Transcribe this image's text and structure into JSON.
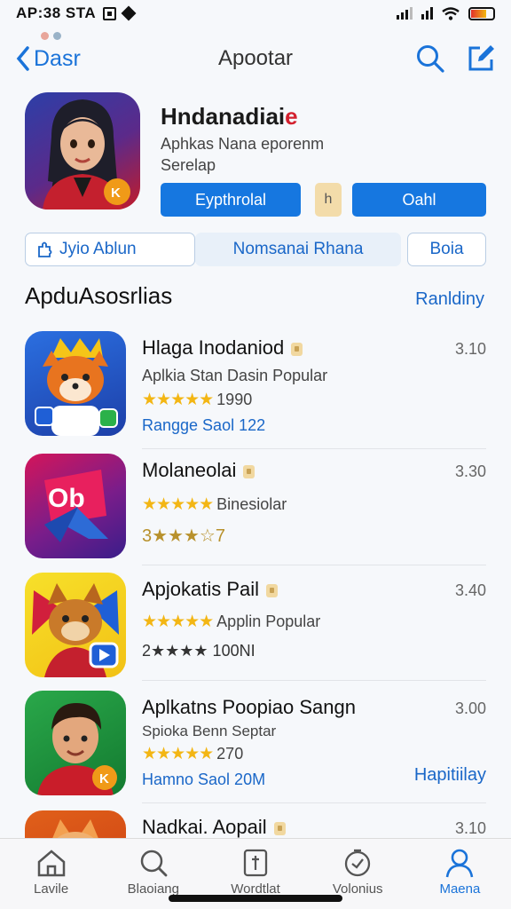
{
  "status": {
    "time": "AP:38 STA"
  },
  "nav": {
    "back_label": "Dasr",
    "title": "Apootar"
  },
  "hero": {
    "title": "Hndanadiai",
    "title_accent": "e",
    "subtitle": "Aphkas Nana eporenm",
    "subtitle2": "Serelap",
    "primary_button": "Eypthrolal",
    "small_button": "h",
    "secondary_button": "Oahl"
  },
  "tabs": [
    {
      "label": "Jyio Ablun"
    },
    {
      "label": "Nomsanai Rhana"
    },
    {
      "label": "Boia"
    }
  ],
  "section": {
    "title": "ApduAsosrlias",
    "link": "Ranldiny"
  },
  "apps": [
    {
      "name": "Hlaga Inodaniod",
      "number": "3.10",
      "line2": "Aplkia Stan Dasin Popular",
      "stars": "★★★★★",
      "line3_rating": "1990",
      "line4": "Rangge Saol 122",
      "colors": [
        "#2b6fe0",
        "#1d3fa8"
      ]
    },
    {
      "name": "Molaneolai",
      "number": "3.30",
      "stars": "★★★★★",
      "line2_after": "Binesiolar",
      "line3": "3★★★☆7",
      "colors": [
        "#d4155a",
        "#3a1d8a"
      ]
    },
    {
      "name": "Apjokatis Pail",
      "number": "3.40",
      "stars": "★★★★★",
      "line2_after": "Applin Popular",
      "line3": "2★★★★ 100NI",
      "colors": [
        "#f2d21a",
        "#1a5ad6"
      ]
    },
    {
      "name": "Aplkatns Poopiao Sangn",
      "number": "3.00",
      "line2": "Spioka Benn Septar",
      "stars": "★★★★★",
      "line3_rating": "270",
      "line4": "Hamno Saol 20M",
      "action": "Hapitiilay",
      "colors": [
        "#1f8a3a",
        "#c91d2a"
      ]
    },
    {
      "name": "Nadkai. Aopail",
      "number": "3.10",
      "colors": [
        "#e0601a",
        "#c93a12"
      ]
    }
  ],
  "tabbar": [
    {
      "label": "Lavile"
    },
    {
      "label": "Blaoiang"
    },
    {
      "label": "Wordtlat"
    },
    {
      "label": "Volonius"
    },
    {
      "label": "Maena"
    }
  ],
  "colors": {
    "accent": "#1677e0",
    "star": "#f3b614"
  }
}
